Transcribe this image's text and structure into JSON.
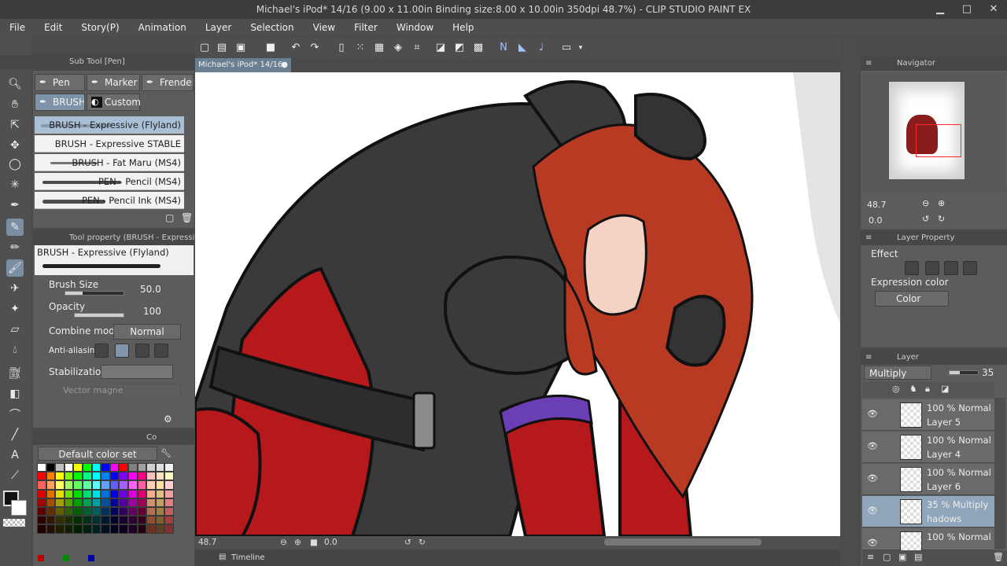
{
  "window": {
    "title": "Michael's iPod* 14/16 (9.00 x 11.00in Binding size:8.00 x 10.00in 350dpi 48.7%) - CLIP STUDIO PAINT EX"
  },
  "menu": {
    "items": [
      "File",
      "Edit",
      "Story(P)",
      "Animation",
      "Layer",
      "Selection",
      "View",
      "Filter",
      "Window",
      "Help"
    ]
  },
  "subtool": {
    "header": "Sub Tool [Pen]",
    "tabs": [
      "Pen",
      "Marker",
      "Frenden",
      "BRUSH",
      "Custom"
    ],
    "brushes": [
      "BRUSH - Expressive (Flyland)",
      "BRUSH - Expressive STABLE",
      "BRUSH - Fat Maru (MS4)",
      "PEN - Pencil (MS4)",
      "PEN - Pencil Ink (MS4)"
    ]
  },
  "toolprop": {
    "header": "Tool property (BRUSH - Expressive",
    "preview_name": "BRUSH - Expressive (Flyland)",
    "brush_size_label": "Brush Size",
    "brush_size_value": "50.0",
    "opacity_label": "Opacity",
    "opacity_value": "100",
    "combine_label": "Combine mode",
    "combine_value": "Normal",
    "aa_label": "Anti-aliasing",
    "stabilization_label": "Stabilization",
    "vector_label": "Vector magnet"
  },
  "colorset": {
    "header": "Co",
    "set_name": "Default color set"
  },
  "canvas": {
    "doc_tab": "Michael's iPod* 14/16",
    "zoom": "48.7",
    "angle": "0.0",
    "timeline_label": "Timeline"
  },
  "navigator": {
    "header": "Navigator",
    "zoom": "48.7",
    "angle": "0.0"
  },
  "layerprop": {
    "header": "Layer Property",
    "effect_label": "Effect",
    "expression_label": "Expression color",
    "expression_value": "Color"
  },
  "layers": {
    "header": "Layer",
    "blend_mode": "Multiply",
    "opacity": "35",
    "items": [
      {
        "pct": "100 %",
        "mode": "Normal",
        "name": "Layer 5",
        "active": false
      },
      {
        "pct": "100 %",
        "mode": "Normal",
        "name": "Layer 4",
        "active": false
      },
      {
        "pct": "100 %",
        "mode": "Normal",
        "name": "Layer 6",
        "active": false
      },
      {
        "pct": "35 %",
        "mode": "Multiply",
        "name": "hadows",
        "active": true
      },
      {
        "pct": "100 %",
        "mode": "Normal",
        "name": "",
        "active": false
      }
    ]
  },
  "colors": {
    "accent": "#7d93a8",
    "panel": "#5c5c5c",
    "hair": "#b83a22",
    "suit": "#3a3a3a",
    "suit_red": "#b5191b",
    "cuff": "#6a3fb5"
  }
}
